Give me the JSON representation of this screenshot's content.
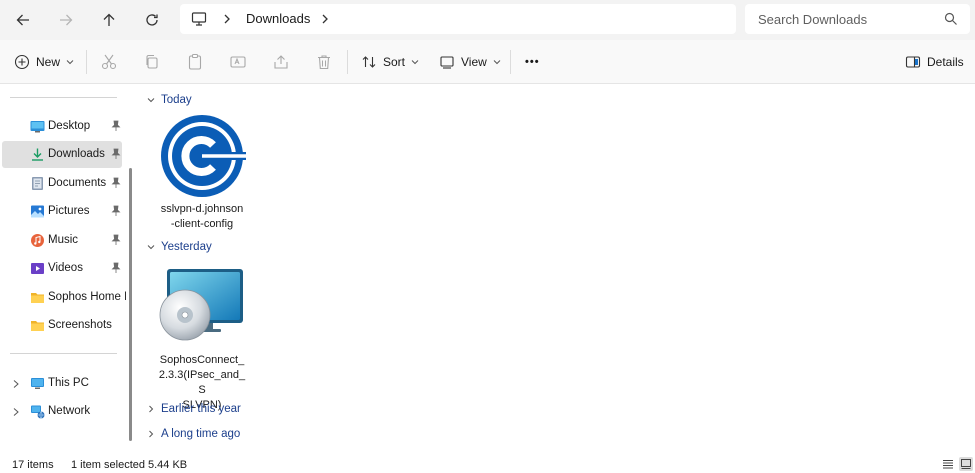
{
  "address": {
    "crumb": "Downloads"
  },
  "search": {
    "placeholder": "Search Downloads"
  },
  "commands": {
    "new_label": "New",
    "sort_label": "Sort",
    "view_label": "View",
    "more_label": "•••",
    "details_label": "Details"
  },
  "sidebar": {
    "quick_access": [
      {
        "label": "Desktop",
        "icon": "desktop-icon",
        "pinned": true
      },
      {
        "label": "Downloads",
        "icon": "download-icon",
        "pinned": true,
        "selected": true
      },
      {
        "label": "Documents",
        "icon": "documents-icon",
        "pinned": true
      },
      {
        "label": "Pictures",
        "icon": "pictures-icon",
        "pinned": true
      },
      {
        "label": "Music",
        "icon": "music-icon",
        "pinned": true
      },
      {
        "label": "Videos",
        "icon": "videos-icon",
        "pinned": true
      },
      {
        "label": "Sophos Home Lab",
        "icon": "folder-icon",
        "pinned": false
      },
      {
        "label": "Screenshots",
        "icon": "folder-icon",
        "pinned": false
      }
    ],
    "roots": [
      {
        "label": "This PC",
        "icon": "this-pc-icon"
      },
      {
        "label": "Network",
        "icon": "network-icon"
      }
    ]
  },
  "content": {
    "groups": {
      "today": "Today",
      "yesterday": "Yesterday",
      "earlier_this_year": "Earlier this year",
      "long_time_ago": "A long time ago"
    },
    "files": [
      {
        "name": "sslvpn-d.johnson-client-config",
        "line1": "sslvpn-d.johnson",
        "line2": "-client-config",
        "icon": "sophos-connect-config-icon"
      },
      {
        "name": "SophosConnect_2.3.3(IPsec_and_SSLVPN)",
        "line1": "SophosConnect_",
        "line2": "2.3.3(IPsec_and_S",
        "line3": "SLVPN)",
        "icon": "installer-disc-icon"
      }
    ]
  },
  "status": {
    "item_count": "17 items",
    "selection": "1 item selected",
    "size": "5.44 KB"
  },
  "colors": {
    "accent_link": "#1c3f8c",
    "sophos_blue": "#0b5db6",
    "selected_bg": "#e0e0e0"
  }
}
